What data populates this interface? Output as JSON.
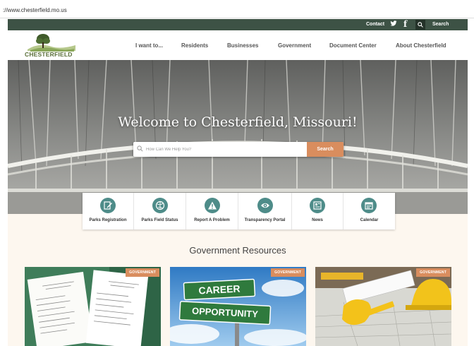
{
  "browser": {
    "url": "://www.chesterfield.mo.us"
  },
  "topbar": {
    "contact": "Contact",
    "search_label": "Search"
  },
  "logo": {
    "text": "CHESTERFIELD"
  },
  "nav": [
    "I want to...",
    "Residents",
    "Businesses",
    "Government",
    "Document Center",
    "About Chesterfield"
  ],
  "hero": {
    "title": "Welcome to Chesterfield, Missouri!",
    "search_placeholder": "How Can We Help You?",
    "search_button": "Search"
  },
  "quick_links": [
    {
      "label": "Parks Registration",
      "icon": "pencil-edit-icon"
    },
    {
      "label": "Parks Field Status",
      "icon": "globe-icon"
    },
    {
      "label": "Report A Problem",
      "icon": "warning-icon"
    },
    {
      "label": "Transparency Portal",
      "icon": "eye-icon"
    },
    {
      "label": "News",
      "icon": "newspaper-icon"
    },
    {
      "label": "Calendar",
      "icon": "calendar-icon"
    }
  ],
  "section": {
    "title": "Government Resources"
  },
  "cards": [
    {
      "tag": "GOVERNMENT"
    },
    {
      "tag": "GOVERNMENT",
      "sign_top": "CAREER",
      "sign_bottom": "OPPORTUNITY"
    },
    {
      "tag": "GOVERNMENT"
    }
  ],
  "colors": {
    "topbar": "#3d5245",
    "accent": "#d98d5e",
    "icon_teal": "#4e8c89",
    "page_bg": "#fdf7ef",
    "sign_green": "#2f7a3d"
  }
}
